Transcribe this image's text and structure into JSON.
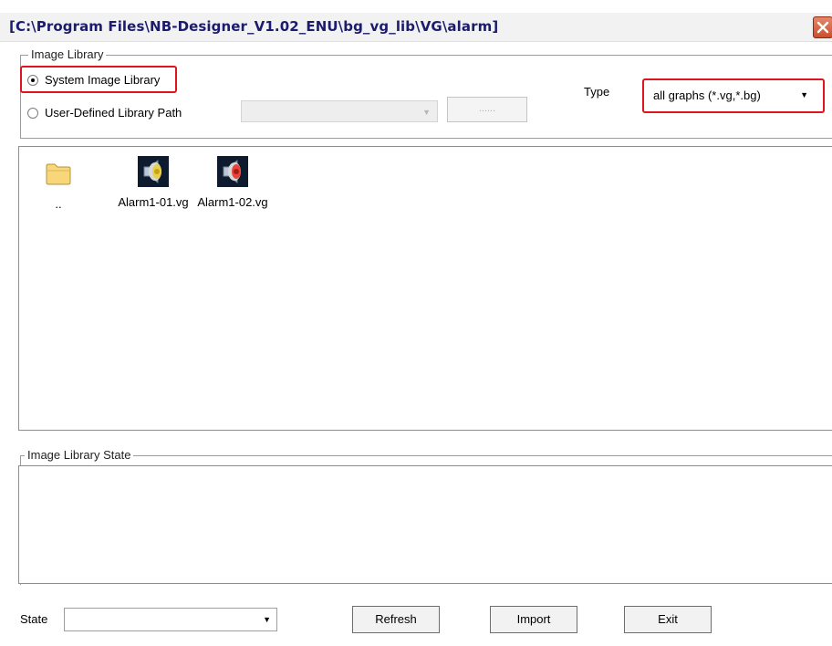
{
  "window": {
    "title": "[C:\\Program Files\\NB-Designer_V1.02_ENU\\bg_vg_lib\\VG\\alarm]",
    "close_icon": "close-icon",
    "close_color": "#d0573a"
  },
  "image_library": {
    "group_label": "Image Library",
    "system_option": {
      "label": "System Image Library",
      "selected": true
    },
    "user_option": {
      "label": "User-Defined Library Path",
      "selected": false
    },
    "path_value": "",
    "browse_label": "......",
    "type_label": "Type",
    "type_value": "all graphs (*.vg,*.bg)",
    "highlight_color": "#e0141e"
  },
  "files": [
    {
      "name": "..",
      "icon": "folder-icon"
    },
    {
      "name": "Alarm1-01.vg",
      "icon": "alarm-speaker-yellow-icon"
    },
    {
      "name": "Alarm1-02.vg",
      "icon": "alarm-speaker-red-icon"
    }
  ],
  "state_group": {
    "label": "Image Library State",
    "content": ""
  },
  "bottom": {
    "state_label": "State",
    "state_value": "",
    "refresh_label": "Refresh",
    "import_label": "Import",
    "exit_label": "Exit"
  }
}
